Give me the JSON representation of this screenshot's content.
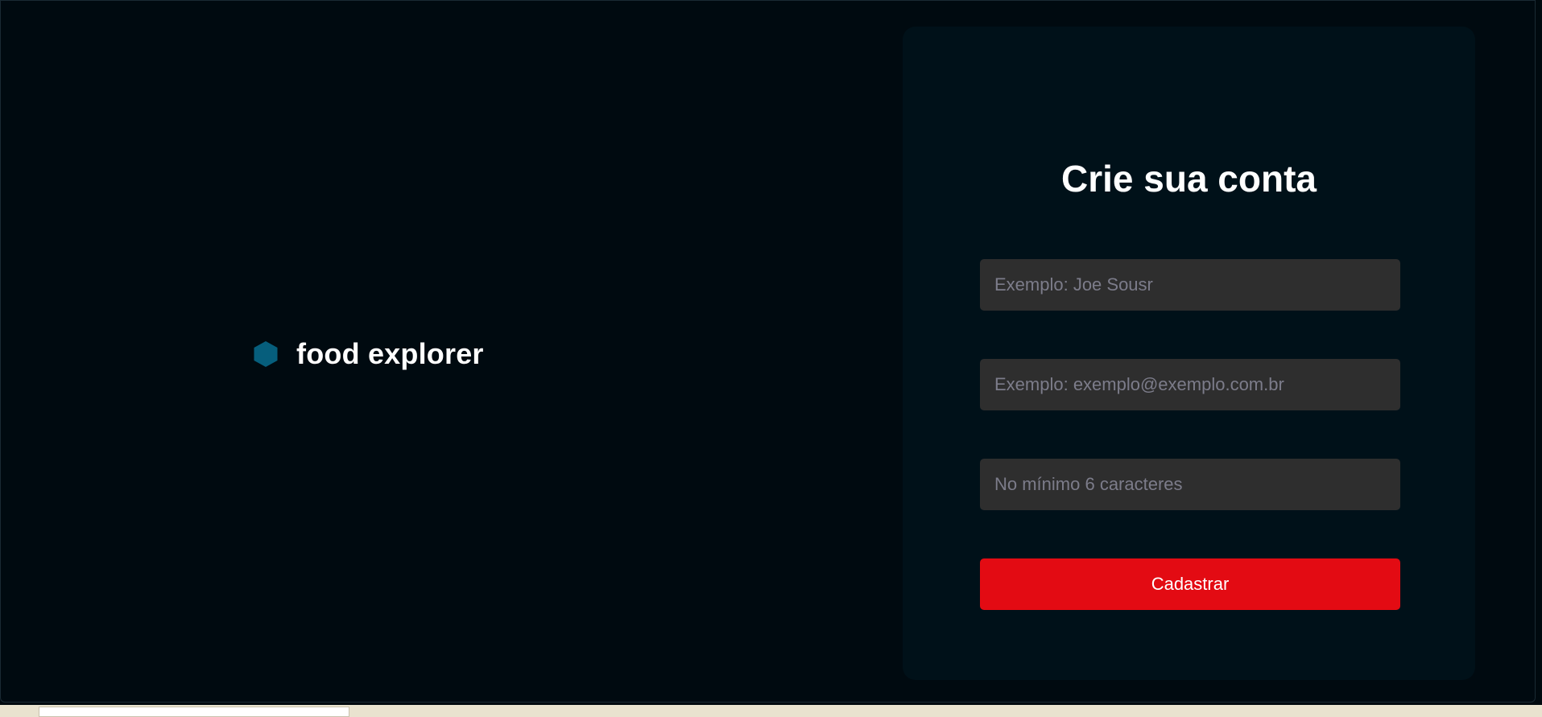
{
  "brand": {
    "name": "food explorer",
    "icon": "hexagon-logo-icon",
    "icon_color": "#065e7c"
  },
  "signup": {
    "title": "Crie sua conta",
    "name_placeholder": "Exemplo: Joe Sousr",
    "email_placeholder": "Exemplo: exemplo@exemplo.com.br",
    "password_placeholder": "No mínimo 6 caracteres",
    "submit_label": "Cadastrar"
  },
  "colors": {
    "background": "#000a10",
    "card": "#001119",
    "input": "#2e2e2e",
    "accent": "#e30b13"
  }
}
